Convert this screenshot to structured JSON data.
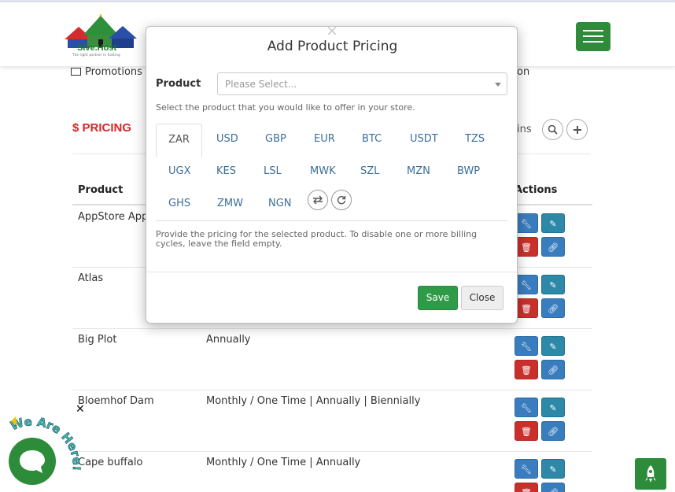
{
  "brand": {
    "name": "Sive.Host",
    "tagline": "The right partner in hosting",
    "accent": "#2f8a3a"
  },
  "nav": {
    "promotions_label": "Promotions",
    "right_fragment": "on"
  },
  "page": {
    "title": "$ PRICING",
    "toolbar_fragment": "ins",
    "title_color": "#d9262c"
  },
  "table": {
    "columns": {
      "product": "Product",
      "actions": "Actions"
    },
    "rows": [
      {
        "product": "AppStore App",
        "cycles": ""
      },
      {
        "product": "Atlas",
        "cycles": ""
      },
      {
        "product": "Big Plot",
        "cycles": "Annually"
      },
      {
        "product": "Bloemhof Dam",
        "cycles": "Monthly / One Time | Annually | Biennially"
      },
      {
        "product": "Cape buffalo",
        "cycles": "Monthly / One Time | Annually"
      }
    ]
  },
  "modal": {
    "title": "Add Product Pricing",
    "close_symbol": "×",
    "product_label": "Product",
    "product_placeholder": "Please Select...",
    "product_help": "Select the product that you would like to offer in your store.",
    "currencies": [
      "ZAR",
      "USD",
      "GBP",
      "EUR",
      "BTC",
      "USDT",
      "TZS",
      "UGX",
      "KES",
      "LSL",
      "MWK",
      "SZL",
      "MZN",
      "BWP",
      "GHS",
      "ZMW",
      "NGN"
    ],
    "active_currency": "ZAR",
    "pricing_help": "Provide the pricing for the selected product. To disable one or more billing cycles, leave the field empty.",
    "save_label": "Save",
    "close_label": "Close"
  },
  "chat": {
    "badge_text": "We Are Here!",
    "dismiss_symbol": "✕"
  }
}
